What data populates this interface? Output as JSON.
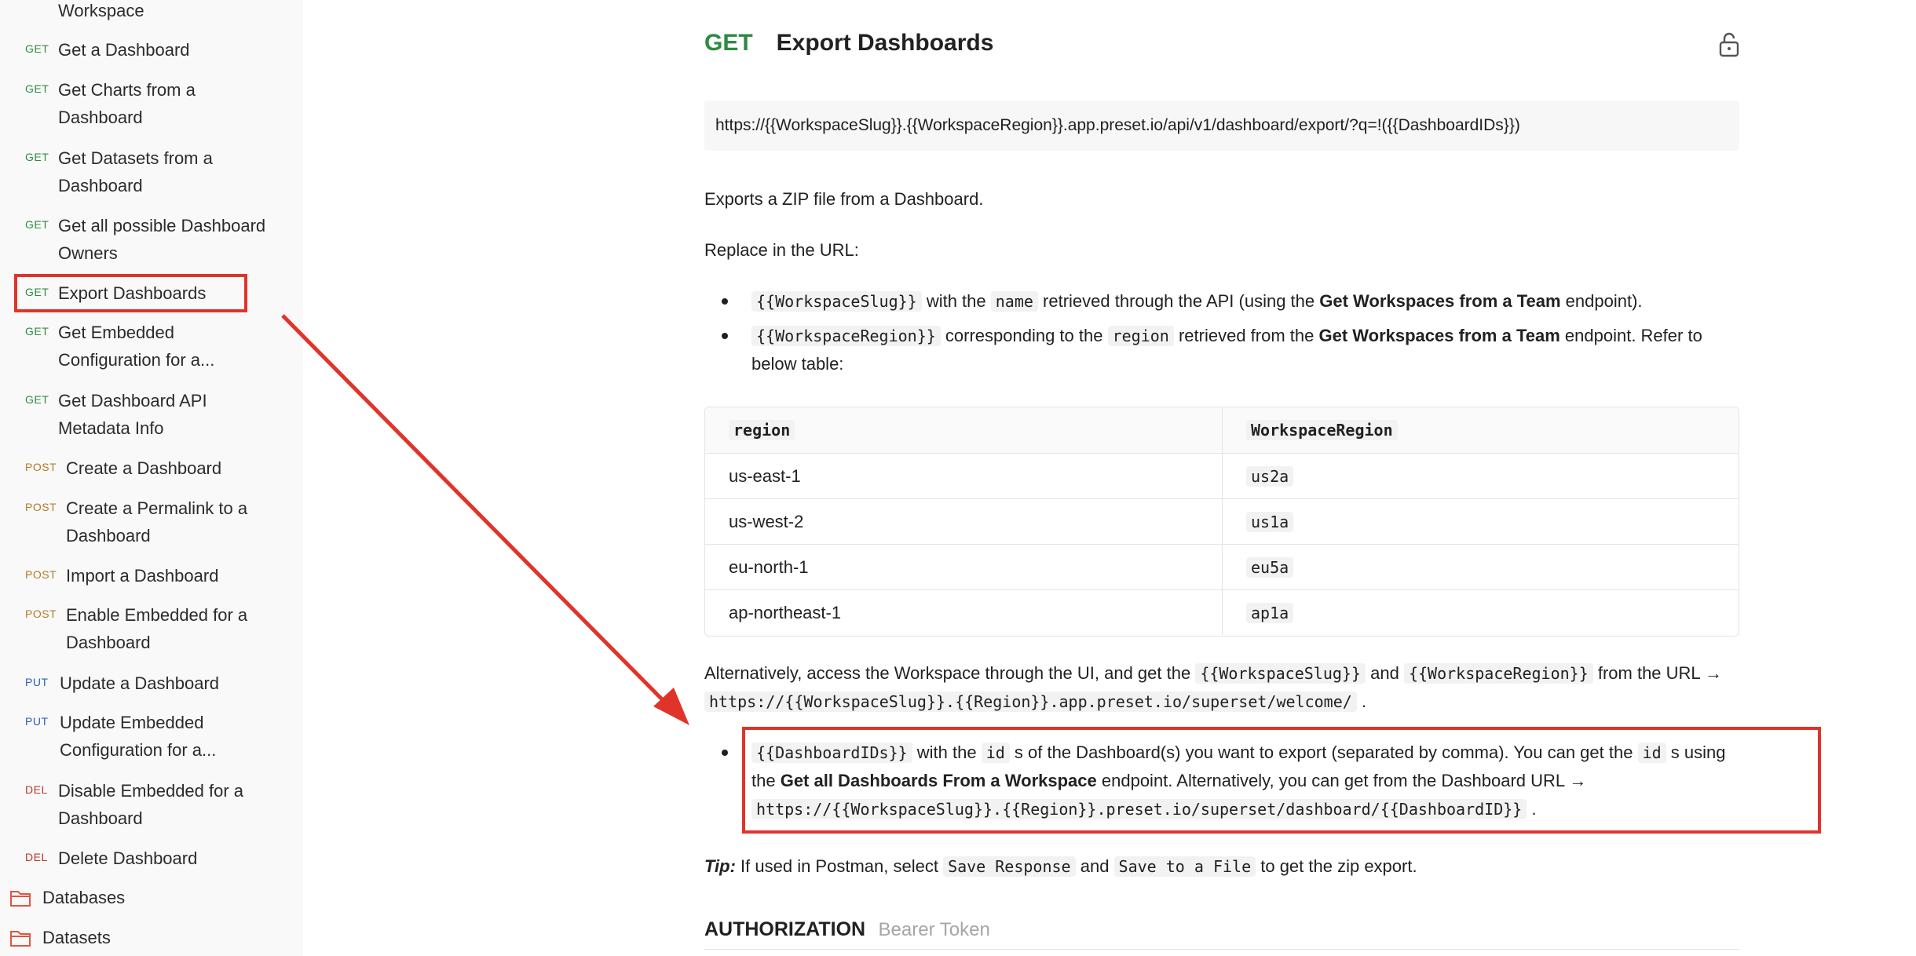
{
  "sidebar": {
    "items": [
      {
        "method": "",
        "label": "Workspace"
      },
      {
        "method": "GET",
        "label": "Get a Dashboard"
      },
      {
        "method": "GET",
        "label": "Get Charts from a Dashboard"
      },
      {
        "method": "GET",
        "label": "Get Datasets from a Dashboard"
      },
      {
        "method": "GET",
        "label": "Get all possible Dashboard Owners"
      },
      {
        "method": "GET",
        "label": "Export Dashboards"
      },
      {
        "method": "GET",
        "label": "Get Embedded Configuration for a..."
      },
      {
        "method": "GET",
        "label": "Get Dashboard API Metadata Info"
      },
      {
        "method": "POST",
        "label": "Create a Dashboard"
      },
      {
        "method": "POST",
        "label": "Create a Permalink to a Dashboard"
      },
      {
        "method": "POST",
        "label": "Import a Dashboard"
      },
      {
        "method": "POST",
        "label": "Enable Embedded for a Dashboard"
      },
      {
        "method": "PUT",
        "label": "Update a Dashboard"
      },
      {
        "method": "PUT",
        "label": "Update Embedded Configuration for a..."
      },
      {
        "method": "DEL",
        "label": "Disable Embedded for a Dashboard"
      },
      {
        "method": "DEL",
        "label": "Delete Dashboard"
      }
    ],
    "folders": [
      "Databases",
      "Datasets"
    ]
  },
  "endpoint": {
    "method": "GET",
    "title": "Export Dashboards",
    "url": "https://{{WorkspaceSlug}}.{{WorkspaceRegion}}.app.preset.io/api/v1/dashboard/export/?q=!({{DashboardIDs}})",
    "description": "Exports a ZIP file from a Dashboard.",
    "replace_intro": "Replace in the URL:",
    "b1": {
      "code1": "{{WorkspaceSlug}}",
      "t1": " with the ",
      "code2": "name",
      "t2": " retrieved through the API (using the ",
      "bold": "Get Workspaces from a Team",
      "t3": " endpoint)."
    },
    "b2": {
      "code1": "{{WorkspaceRegion}}",
      "t1": " corresponding to the ",
      "code2": "region",
      "t2": " retrieved from the ",
      "bold": "Get Workspaces from a Team",
      "t3": " endpoint. Refer to below table:"
    },
    "table": {
      "headers": [
        "region",
        "WorkspaceRegion"
      ],
      "rows": [
        [
          "us-east-1",
          "us2a"
        ],
        [
          "us-west-2",
          "us1a"
        ],
        [
          "eu-north-1",
          "eu5a"
        ],
        [
          "ap-northeast-1",
          "ap1a"
        ]
      ]
    },
    "alt": {
      "t1": "Alternatively, access the Workspace through the UI, and get the ",
      "code1": "{{WorkspaceSlug}}",
      "t2": " and ",
      "code2": "{{WorkspaceRegion}}",
      "t3": " from the URL → ",
      "code3": "https://{{WorkspaceSlug}}.{{Region}}.app.preset.io/superset/welcome/",
      "t4": " ."
    },
    "b3": {
      "code1": "{{DashboardIDs}}",
      "t1": " with the ",
      "code2": "id",
      "t2": " s of the Dashboard(s) you want to export (separated by comma). You can get the ",
      "code3": "id",
      "t3": " s using the ",
      "bold": "Get all Dashboards From a Workspace",
      "t4": " endpoint. Alternatively, you can get from the Dashboard URL → ",
      "code4": "https://{{WorkspaceSlug}}.{{Region}}.preset.io/superset/dashboard/{{DashboardID}}",
      "t5": " ."
    },
    "tip": {
      "label": "Tip:",
      "t1": " If used in Postman, select ",
      "code1": "Save Response",
      "t2": " and ",
      "code2": "Save to a File",
      "t3": " to get the zip export."
    },
    "auth": {
      "title": "AUTHORIZATION",
      "type": "Bearer Token"
    }
  },
  "colors": {
    "get": "#2e8a41",
    "post": "#b07a2a",
    "put": "#2e5fb3",
    "del": "#b33a2b",
    "annotation": "#e0342a"
  }
}
